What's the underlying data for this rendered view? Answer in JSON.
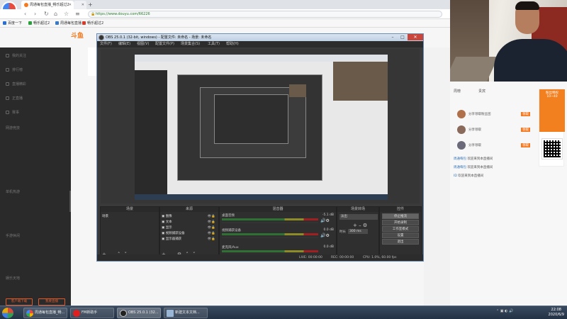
{
  "browser": {
    "logo_label": "分享领取",
    "tabs": [
      {
        "label": "周通每包直播_畅乐超过2",
        "active": true
      },
      {
        "label": "",
        "active": false
      }
    ],
    "new_tab": "+",
    "url": "https://www.douyu.com/66226",
    "bookmarks": [
      "百度一下",
      "畅乐超过2",
      "周通每包直播",
      "畅乐超过2"
    ]
  },
  "douyu": {
    "logo": "斗鱼",
    "sidebar": {
      "items": [
        "我的关注",
        "排行榜",
        "直播精彩",
        "正直播",
        "赛事"
      ],
      "sections": [
        "网游竞技",
        "单机热游",
        "手游休闲",
        "娱乐天地"
      ],
      "buttons": [
        "客户端下载",
        "我要直播"
      ]
    }
  },
  "obs": {
    "title": "OBS 25.0.1 (32-bit, windows) - 配置文件: 未命名 - 场景: 未命名",
    "menu": [
      "文件(F)",
      "编辑(E)",
      "视图(V)",
      "配置文件(P)",
      "场景集合(S)",
      "工具(T)",
      "帮助(H)"
    ],
    "docks": {
      "scenes": {
        "title": "场景",
        "items": [
          "场景"
        ]
      },
      "sources": {
        "title": "来源",
        "items": [
          "图像",
          "文本",
          "显示",
          "视频捕获设备",
          "显示器捕获"
        ]
      },
      "mixer": {
        "title": "混音器",
        "channels": [
          {
            "label": "桌面音频",
            "db": "-5.1 dB"
          },
          {
            "label": "视频捕获设备",
            "db": "0.0 dB"
          },
          {
            "label": "麦克风/Aux",
            "db": "0.0 dB"
          }
        ]
      },
      "transitions": {
        "title": "场景转场",
        "type": "淡出",
        "duration_label": "时长",
        "duration": "300 ms"
      },
      "controls": {
        "title": "控件",
        "buttons": [
          "停止推流",
          "开始录制",
          "工作室模式",
          "设置",
          "退出"
        ]
      }
    },
    "status": {
      "live": "LIVE: 00:00:00",
      "rec": "REC: 00:00:00",
      "cpu": "CPU: 1.0%, 60.00 fps"
    }
  },
  "chat": {
    "tabs": [
      "周榜",
      "贵宾"
    ],
    "fans": [
      {
        "text": "分享领取粉丝团",
        "tag": "领取"
      },
      {
        "text": "分享领取",
        "tag": "领取"
      },
      {
        "text": "分享领取",
        "tag": "领取"
      }
    ],
    "messages": [
      {
        "user": "周通每包",
        "text": "欢迎来到本直播间"
      },
      {
        "user": "周通每包",
        "text": "欢迎来到本直播间"
      },
      {
        "user": "ID",
        "text": "欢迎来到本直播间"
      }
    ],
    "promo_text": "粉丝特权",
    "promo_sub": "10~40"
  },
  "taskbar": {
    "buttons": [
      "周通每包直播_畅...",
      "FM新助手",
      "OBS 25.0.1 (32...",
      "新建文本文档..."
    ],
    "clock_time": "22:08",
    "clock_date": "2020/6/9"
  },
  "colors": {
    "douyu_orange": "#f47920",
    "obs_bg": "#3a3a3a"
  }
}
